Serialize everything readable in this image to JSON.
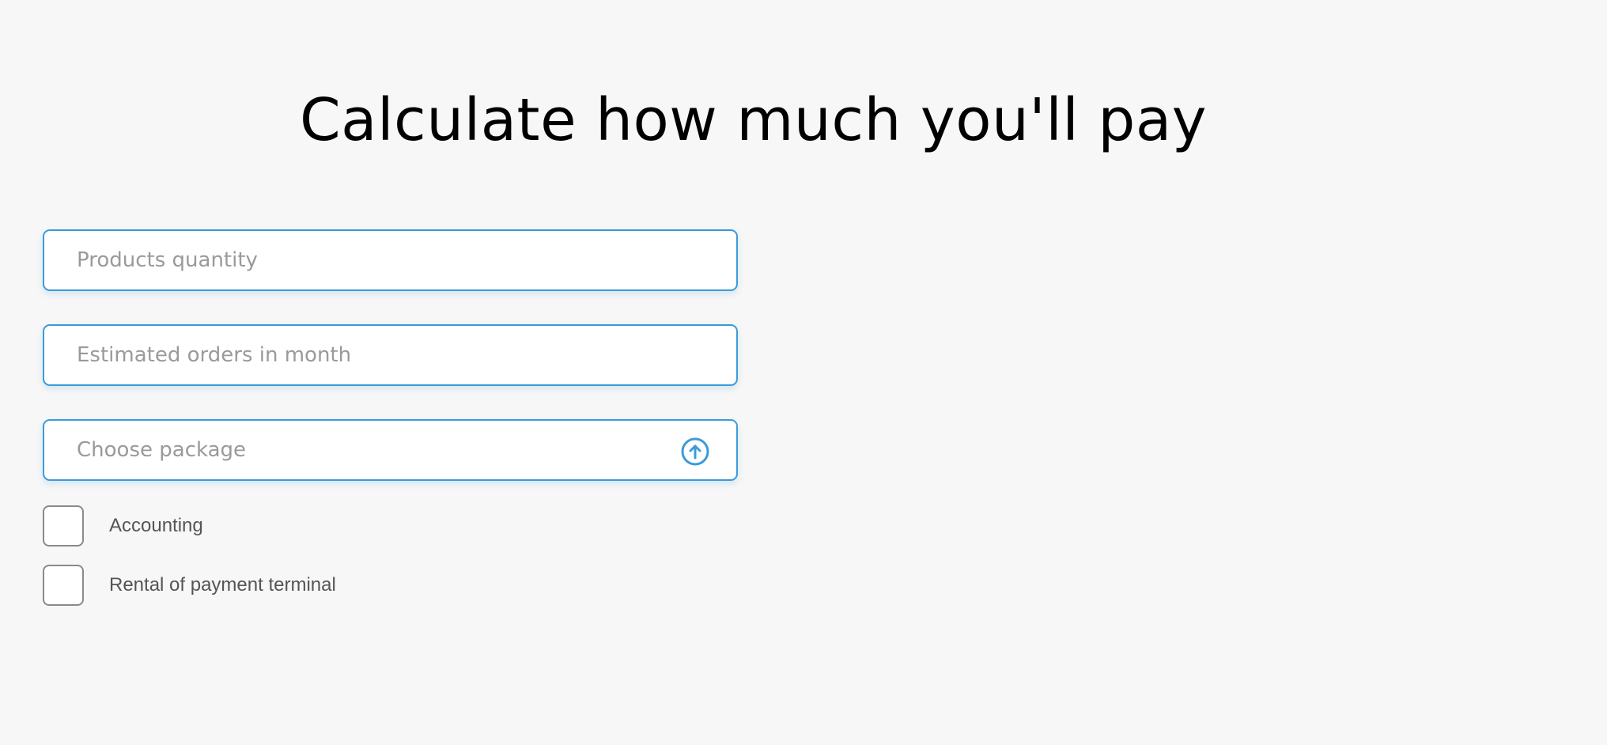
{
  "page": {
    "title": "Calculate how much you'll pay"
  },
  "form": {
    "products_quantity": {
      "placeholder": "Products quantity",
      "value": ""
    },
    "estimated_orders": {
      "placeholder": "Estimated orders in month",
      "value": ""
    },
    "package_select": {
      "placeholder": "Choose package",
      "icon": "arrow-up-circle-icon"
    },
    "options": [
      {
        "label": "Accounting",
        "checked": false
      },
      {
        "label": "Rental of payment terminal",
        "checked": false
      }
    ]
  },
  "colors": {
    "accent": "#3a9bd9",
    "background": "#f7f7f7",
    "placeholder": "#9a9a9a",
    "label": "#555555",
    "checkbox_border": "#8a8a8a"
  }
}
